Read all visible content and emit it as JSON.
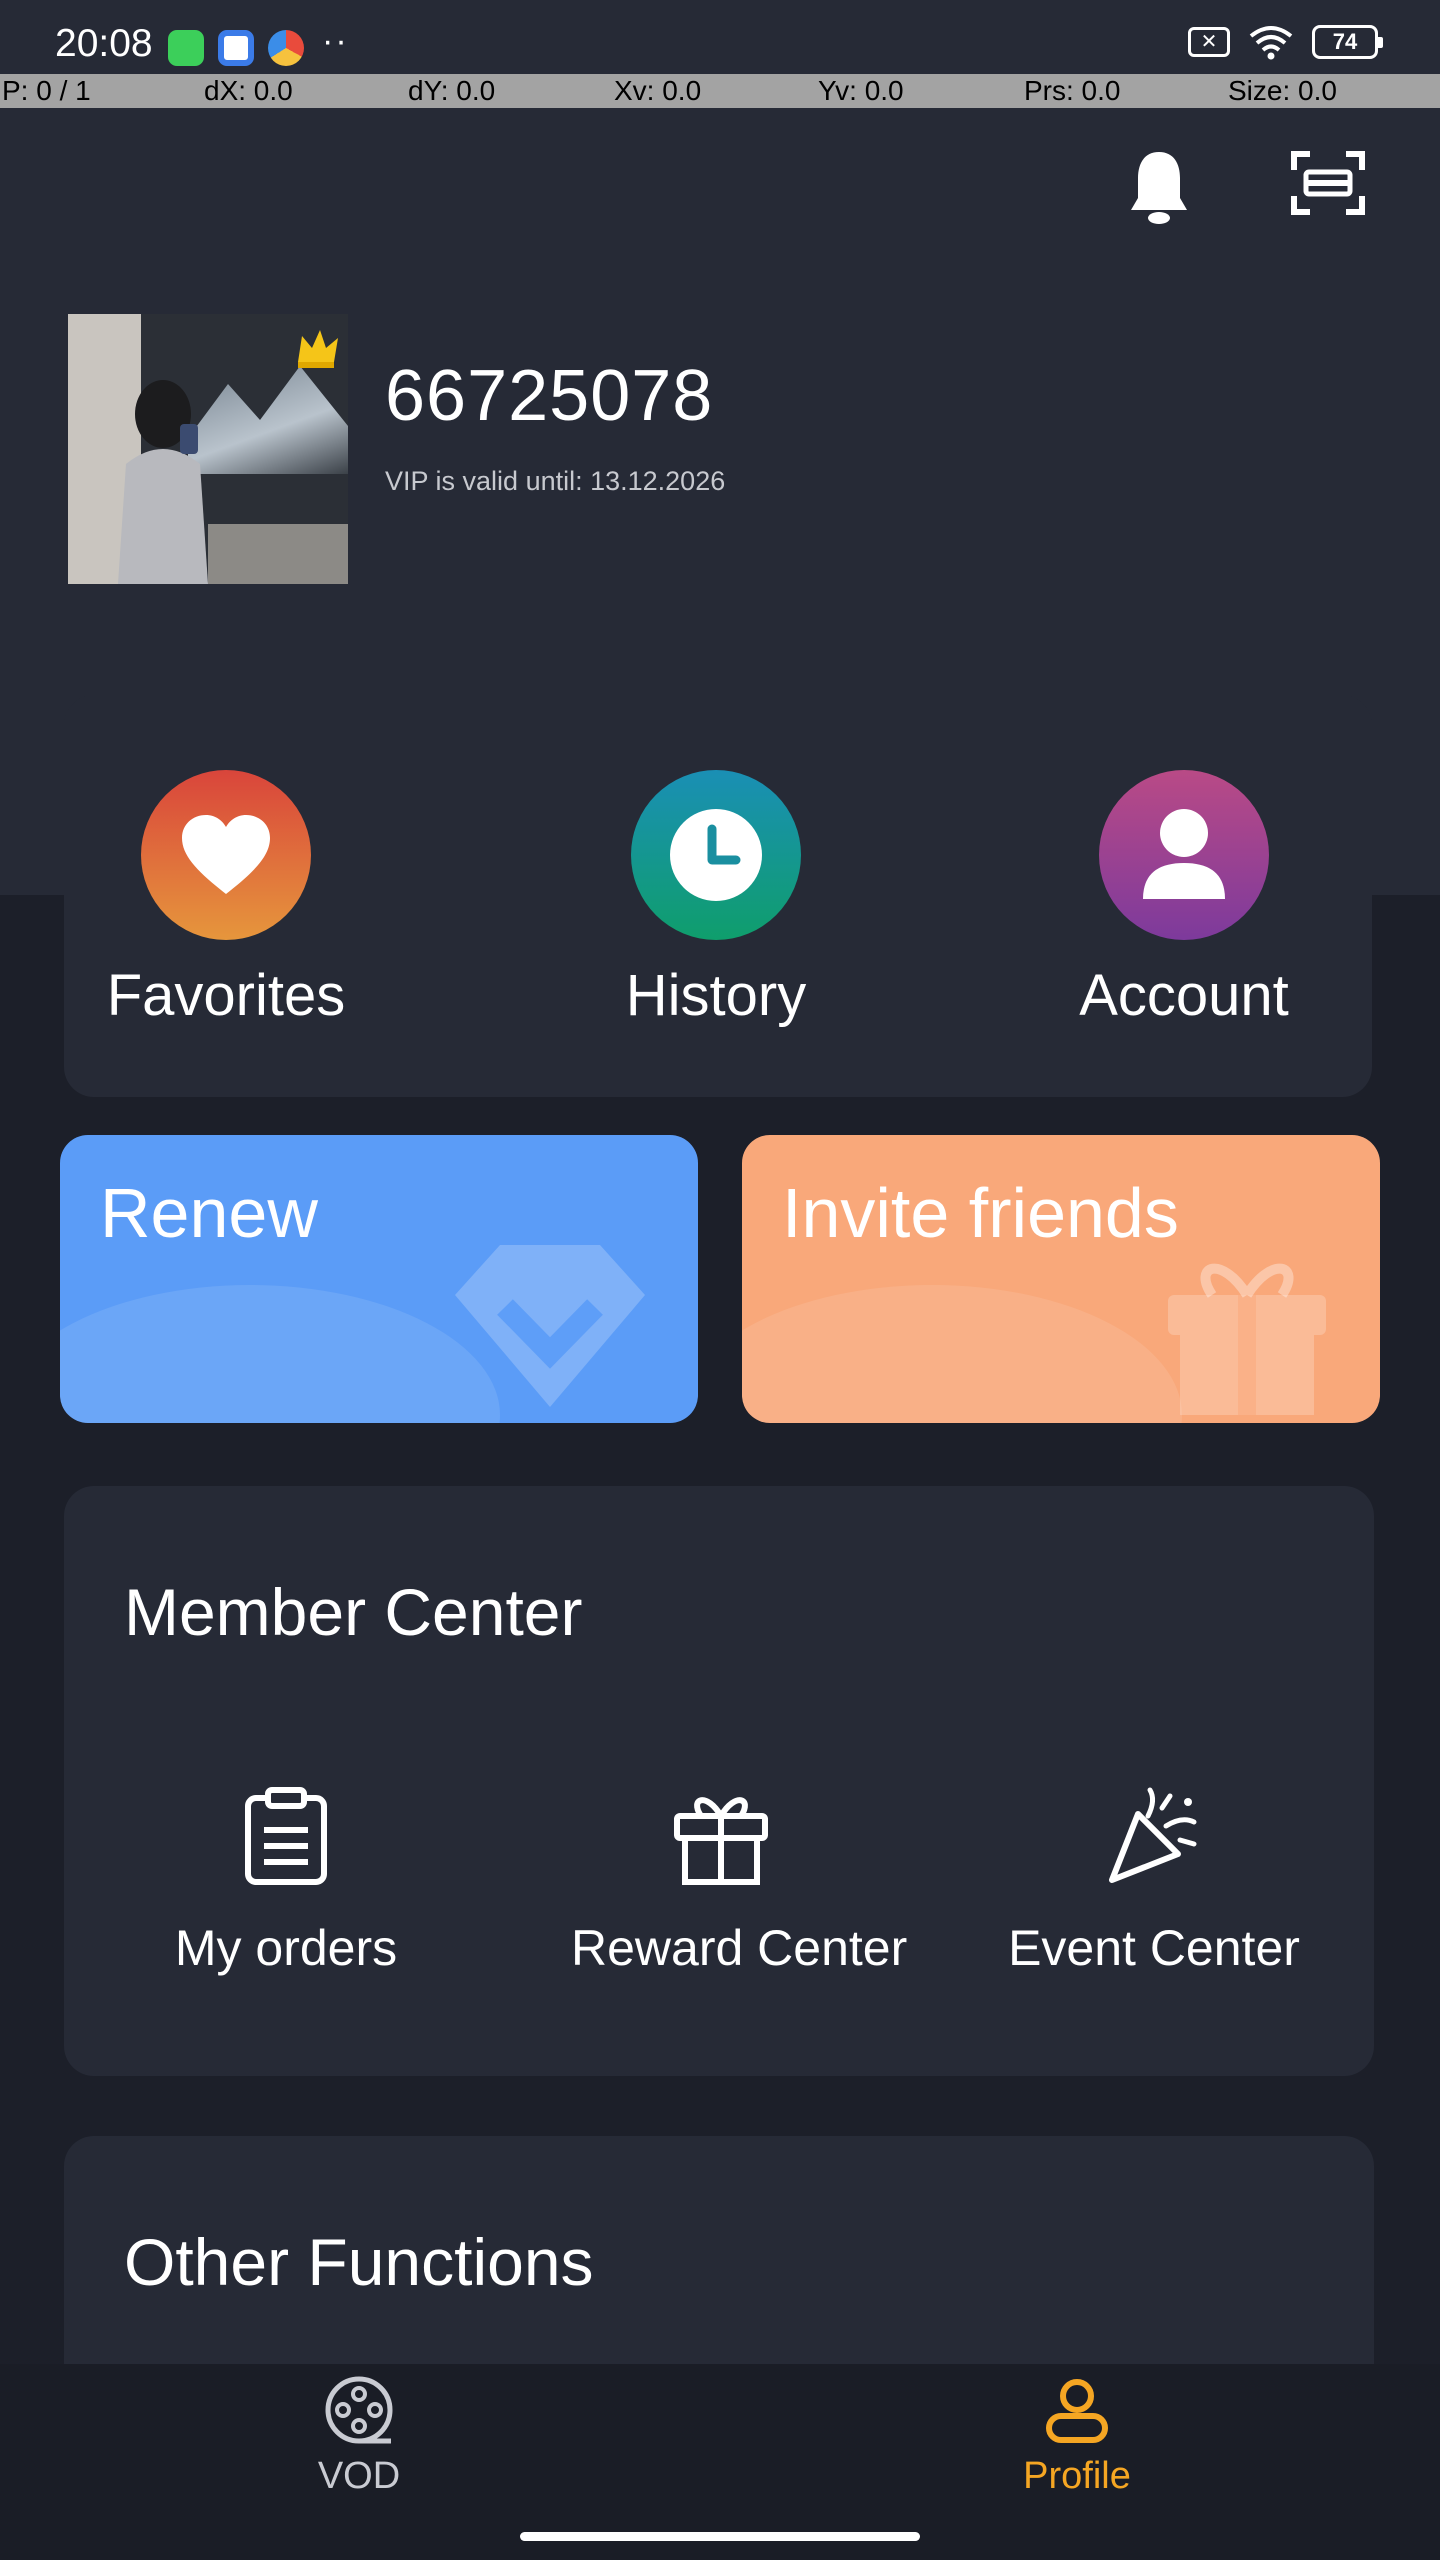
{
  "status_bar": {
    "time": "20:08",
    "more": "··",
    "sim": "✕",
    "battery": "74"
  },
  "debug_bar": {
    "pointer": "P: 0 / 1",
    "dx": "dX: 0.0",
    "dy": "dY: 0.0",
    "xv": "Xv: 0.0",
    "yv": "Yv: 0.0",
    "prs": "Prs: 0.0",
    "size": "Size: 0.0"
  },
  "header": {
    "notification_icon": "bell-icon",
    "scan_icon": "scan-icon"
  },
  "profile": {
    "user_id": "66725078",
    "vip_status": "VIP is valid until: 13.12.2026"
  },
  "quick_actions": [
    {
      "label": "Favorites",
      "icon": "heart-icon",
      "color_from": "#d9453b",
      "color_to": "#e6963c"
    },
    {
      "label": "History",
      "icon": "clock-icon",
      "color_from": "#1a8fb5",
      "color_to": "#0f9e6c"
    },
    {
      "label": "Account",
      "icon": "user-icon",
      "color_from": "#b94a86",
      "color_to": "#7d3a9c"
    }
  ],
  "promos": {
    "renew": {
      "label": "Renew",
      "color": "#5b9cf7"
    },
    "invite": {
      "label": "Invite friends",
      "color": "#f9a87a"
    }
  },
  "member_center": {
    "title": "Member Center",
    "items": [
      {
        "label": "My orders",
        "icon": "clipboard-icon"
      },
      {
        "label": "Reward Center",
        "icon": "gift-icon"
      },
      {
        "label": "Event Center",
        "icon": "party-popper-icon"
      }
    ]
  },
  "other_functions": {
    "title": "Other Functions"
  },
  "bottom_nav": {
    "vod": {
      "label": "VOD",
      "icon": "film-reel-icon",
      "color": "#c9cbd2"
    },
    "profile": {
      "label": "Profile",
      "icon": "profile-icon",
      "color": "#f5a623"
    }
  }
}
